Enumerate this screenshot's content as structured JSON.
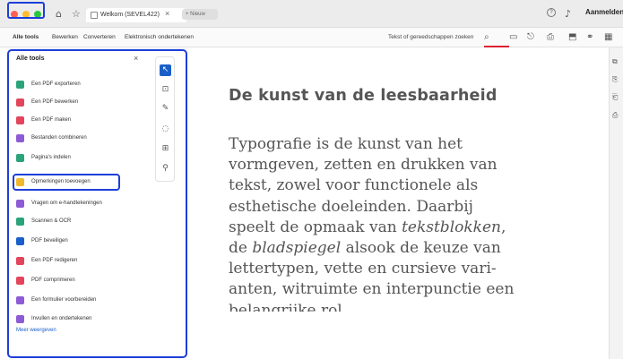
{
  "titlebar": {
    "colors": {
      "close": "#ff5f57",
      "min": "#febc2e",
      "max": "#28c840"
    },
    "tab_title": "Welkom (SEVEL422)",
    "tab_close": "×",
    "new_tab": "+ Nieuw",
    "help_icon": "?",
    "sign_in": "Aanmelden"
  },
  "menubar": {
    "items": [
      "Alle tools",
      "Bewerken",
      "Converteren",
      "Elektronisch ondertekenen"
    ],
    "search_placeholder": "Tekst of gereedschappen zoeken",
    "search_icon": "⌕"
  },
  "panel": {
    "title": "Alle tools",
    "close": "×",
    "tools": [
      {
        "label": "Een PDF exporteren",
        "color": "#2aa37a"
      },
      {
        "label": "Een PDF bewerken",
        "color": "#e2455c"
      },
      {
        "label": "Een PDF maken",
        "color": "#e2455c"
      },
      {
        "label": "Bestanden combineren",
        "color": "#8e5bd6"
      },
      {
        "label": "Pagina's indelen",
        "color": "#2aa37a"
      },
      {
        "label": "Opmerkingen toevoegen",
        "color": "#f0b82a"
      },
      {
        "label": "Vragen om e-handtekeningen",
        "color": "#8e5bd6"
      },
      {
        "label": "Scannen & OCR",
        "color": "#2aa37a"
      },
      {
        "label": "PDF beveiligen",
        "color": "#1a5fc9"
      },
      {
        "label": "Een PDF redigeren",
        "color": "#e2455c"
      },
      {
        "label": "PDF comprimeren",
        "color": "#e2455c"
      },
      {
        "label": "Een formulier voorbereiden",
        "color": "#8e5bd6"
      },
      {
        "label": "Invullen en ondertekenen",
        "color": "#8e5bd6"
      }
    ],
    "more_link": "Meer weergeven"
  },
  "vtoolbar": {
    "icons": [
      "select-icon",
      "comment-icon",
      "pen-icon",
      "lasso-icon",
      "text-select-icon",
      "stamp-icon"
    ],
    "glyphs": [
      "↖",
      "⊡",
      "✎",
      "◌",
      "⊞",
      "⚲"
    ]
  },
  "document": {
    "heading": "De kunst van de leesbaarheid",
    "lines": [
      "Typografie is de kunst van het",
      "vormgeven, zetten en drukken van",
      "tekst, zowel voor functionele als",
      "esthetische doeleinden. Daarbij",
      "speelt de opmaak van ",
      "de ",
      "lettertypen, vette en cursieve vari-",
      "anten, witruimte en interpunctie een",
      "belangrijke rol."
    ],
    "italic_1": "tekstblokken",
    "italic_1_tail": ",",
    "italic_2": "bladspiegel",
    "italic_2_tail": " alsook de keuze van"
  },
  "rail": {
    "glyphs": [
      "⧉",
      "⎘",
      "⎗",
      "⎙"
    ]
  }
}
